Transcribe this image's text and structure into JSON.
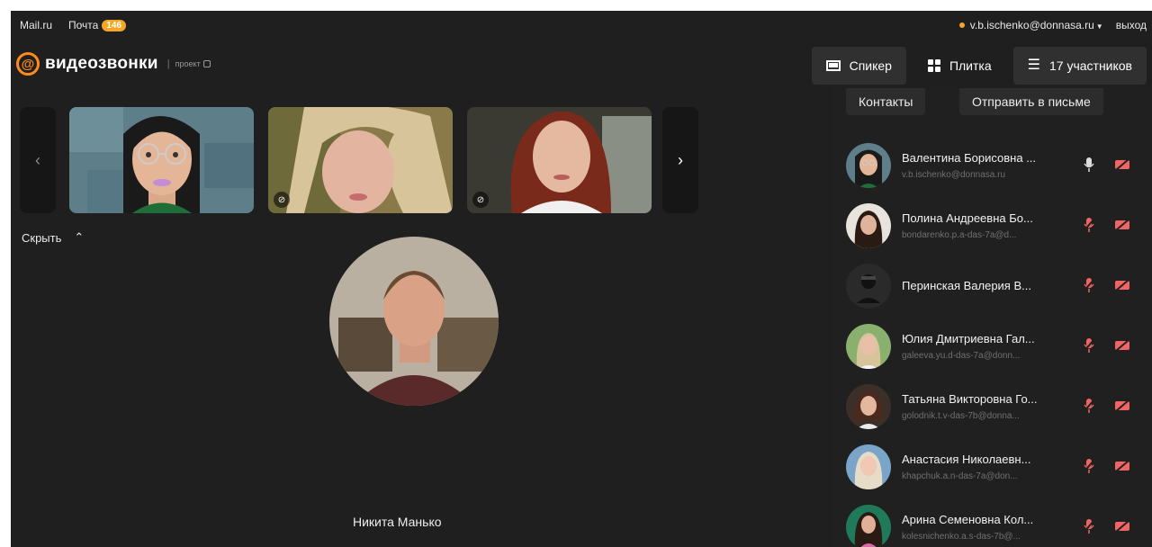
{
  "portal": {
    "site": "Mail.ru",
    "mail_label": "Почта",
    "mail_count": "146",
    "user_email": "v.b.ischenko@donnasa.ru",
    "logout": "выход"
  },
  "header": {
    "logo_text": "видеозвонки",
    "project_label": "проект"
  },
  "views": [
    {
      "label": "Спикер",
      "icon": "speaker-view-icon",
      "active": true
    },
    {
      "label": "Плитка",
      "icon": "grid-icon",
      "active": false
    },
    {
      "label": "17 участников",
      "icon": "list-icon",
      "active": true
    }
  ],
  "strip": {
    "prev_icon": "chevron-left-icon",
    "next_icon": "chevron-right-icon",
    "prev_glyph": "‹",
    "next_glyph": "›"
  },
  "hide_toggle": {
    "label": "Скрыть",
    "icon": "chevron-up-icon",
    "glyph": "⌃"
  },
  "speaker": {
    "name": "Никита Манько"
  },
  "panel": {
    "contacts_label": "Контакты",
    "send_label": "Отправить в письме"
  },
  "participants": [
    {
      "name": "Валентина Борисовна ...",
      "email": "v.b.ischenko@donnasa.ru",
      "mic_on": true
    },
    {
      "name": "Полина Андреевна Бо...",
      "email": "bondarenko.p.a-das-7a@d...",
      "mic_on": false
    },
    {
      "name": "Перинская Валерия В...",
      "email": "",
      "mic_on": false
    },
    {
      "name": "Юлия Дмитриевна Гал...",
      "email": "galeeva.yu.d-das-7a@donn...",
      "mic_on": false
    },
    {
      "name": "Татьяна Викторовна Го...",
      "email": "golodnik.t.v-das-7b@donna...",
      "mic_on": false
    },
    {
      "name": "Анастасия Николаевн...",
      "email": "khapchuk.a.n-das-7a@don...",
      "mic_on": false
    },
    {
      "name": "Арина Семеновна Кол...",
      "email": "kolesnichenko.a.s-das-7b@...",
      "mic_on": false
    }
  ],
  "colors": {
    "accent": "#ff8c1a",
    "badge": "#f5a623",
    "background": "#1f1f1f",
    "muted_red": "#f06464"
  }
}
